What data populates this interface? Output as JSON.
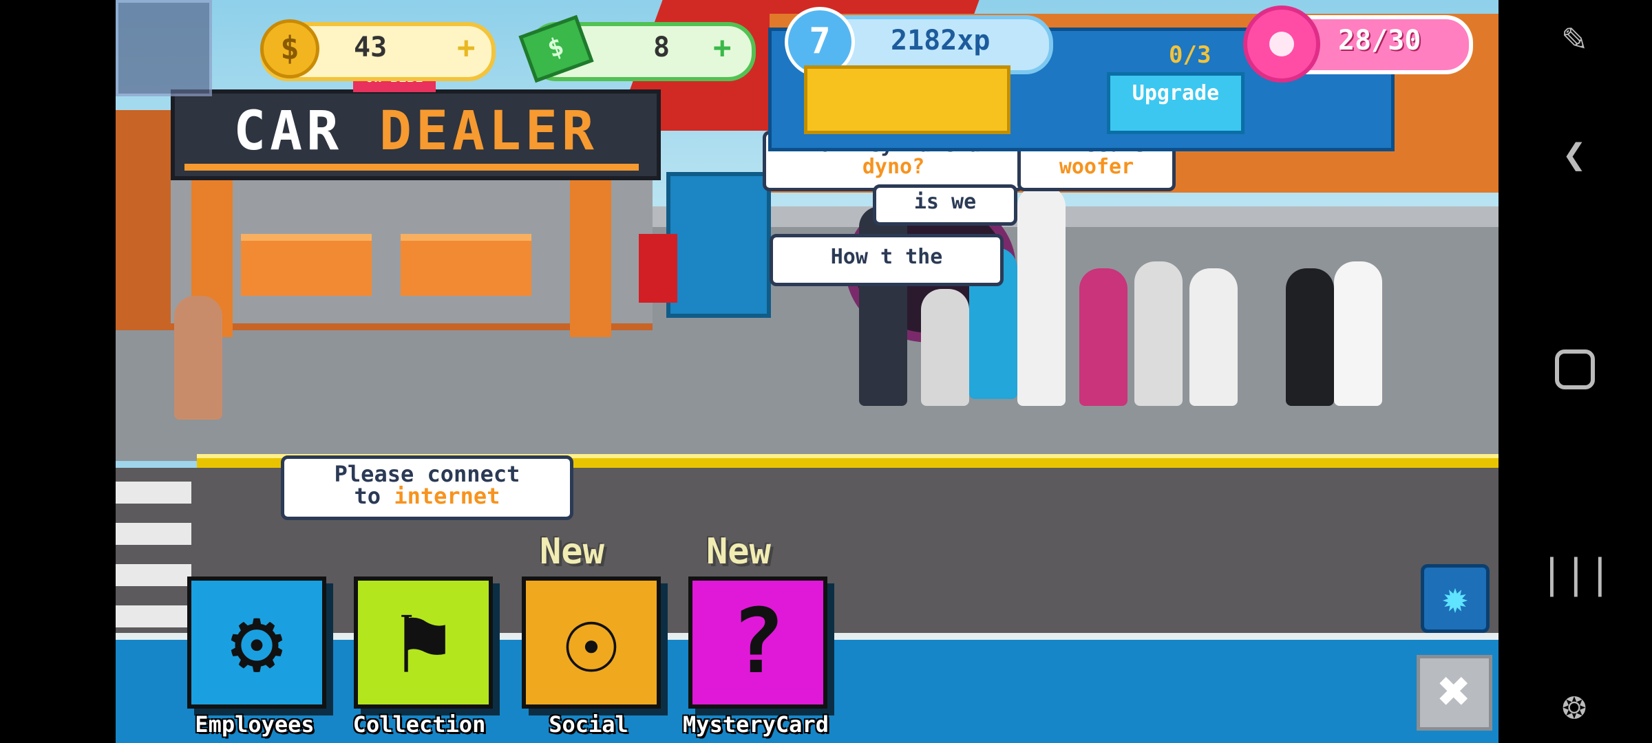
{
  "hud": {
    "coins": "43",
    "coins_plus": "+",
    "cash": "8",
    "cash_plus": "+",
    "level": "7",
    "xp": "2182xp",
    "seats": "0/3",
    "donuts": "28/30",
    "upgrade_label": "Upgrade",
    "promo_tag": "Oh BIBI",
    "coin_symbol": "$"
  },
  "scene": {
    "dealer_sign_word1": "CAR",
    "dealer_sign_word2": "DEALER",
    "bubble_dyno_line1": "Do they have a",
    "bubble_dyno_line2": "dyno?",
    "bubble_need_line1": "I need s",
    "bubble_need_line2": "woofer",
    "bubble_how": "How   t the",
    "bubble_is": "is we",
    "internet_line1": "Please connect",
    "internet_line2_a": "to ",
    "internet_line2_b": "internet"
  },
  "menu": {
    "employees": "Employees",
    "collection": "Collection",
    "social": "Social",
    "mystery": "MysteryCard",
    "new_badge": "New"
  },
  "colors": {
    "employees": "#1aa0e0",
    "collection": "#b4e61e",
    "social": "#f0a81e",
    "mystery": "#e019d8",
    "settings": "#1d6fb8"
  },
  "nav": {
    "game_tools_icon": "game-tools-icon",
    "back_icon": "back-icon",
    "home_icon": "home-icon",
    "recents_icon": "recents-icon",
    "controller_icon": "controller-icon"
  }
}
